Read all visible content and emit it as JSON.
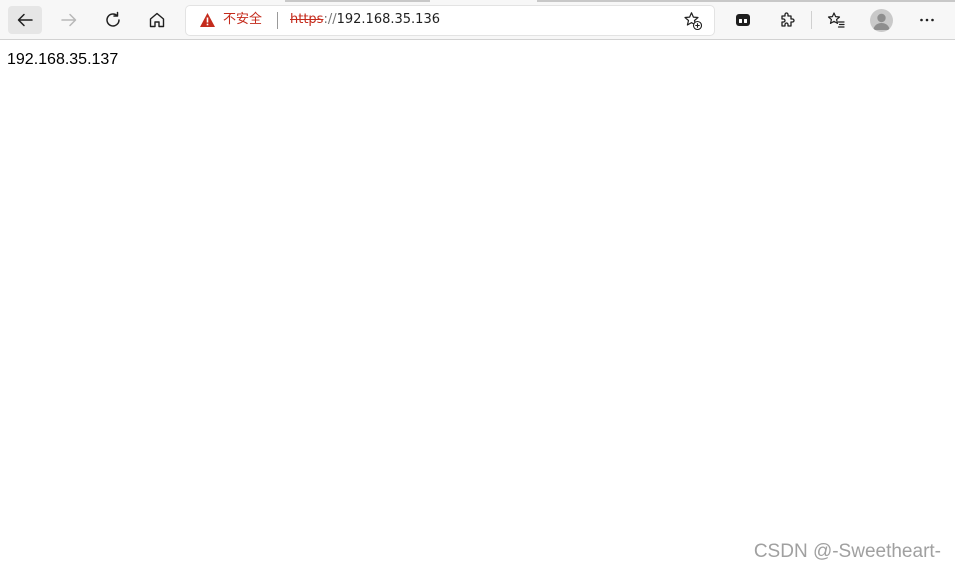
{
  "toolbar": {
    "back": {
      "icon": "back-arrow-icon"
    },
    "forward": {
      "icon": "forward-arrow-icon"
    },
    "refresh": {
      "icon": "refresh-icon"
    },
    "home": {
      "icon": "home-icon"
    },
    "tab_actions": {
      "icon": "tab-actions-icon"
    },
    "extensions": {
      "icon": "puzzle-icon"
    },
    "favorites": {
      "icon": "favorites-list-icon"
    },
    "profile": {
      "icon": "avatar-icon"
    },
    "more": {
      "icon": "ellipsis-icon"
    }
  },
  "address_bar": {
    "security_label": "不安全",
    "security_icon": "warning-triangle-icon",
    "url_scheme": "https",
    "url_separator": "://",
    "url_host": "192.168.35.136",
    "add_favorite_icon": "star-plus-icon"
  },
  "page": {
    "body_text": "192.168.35.137"
  },
  "watermark": {
    "text": "CSDN @-Sweetheart-"
  },
  "colors": {
    "toolbar_bg": "#f7f7f7",
    "warning_red": "#c42b1c",
    "page_bg": "#ffffff",
    "watermark": "#a0a0a0"
  }
}
